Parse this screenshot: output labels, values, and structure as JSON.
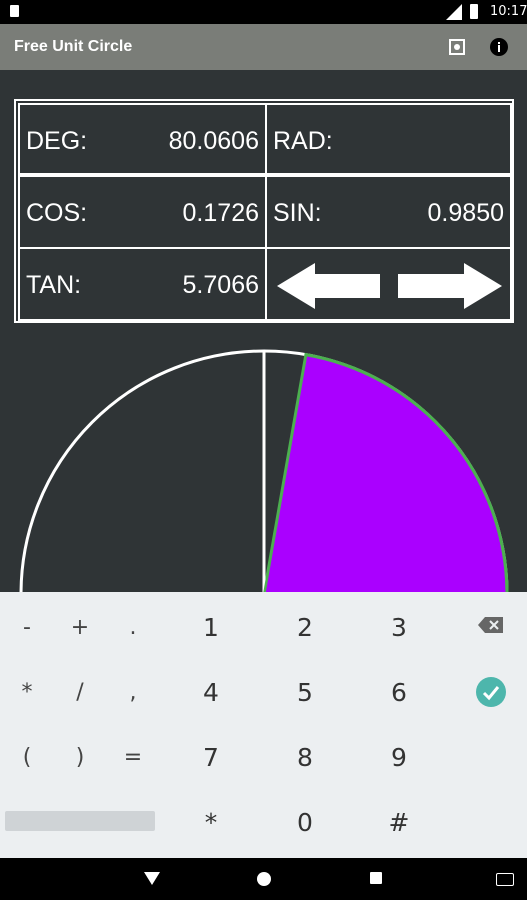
{
  "status_bar": {
    "time": "10:17"
  },
  "app_bar": {
    "title": "Free Unit Circle"
  },
  "values": {
    "deg_label": "DEG:",
    "deg_value": "80.0606",
    "rad_label": "RAD:",
    "rad_value": "",
    "cos_label": "COS:",
    "cos_value": "0.1726",
    "sin_label": "SIN:",
    "sin_value": "0.9850",
    "tan_label": "TAN:",
    "tan_value": "5.7066"
  },
  "circle": {
    "angle_degrees": 80.0606,
    "sector_color": "#aa00ff",
    "arc_color": "#4caf50",
    "outline_color": "#ffffff"
  },
  "keyboard": {
    "rows": [
      [
        "-",
        "+",
        ".",
        "1",
        "2",
        "3"
      ],
      [
        "*",
        "/",
        ",",
        "4",
        "5",
        "6"
      ],
      [
        "(",
        ")",
        "=",
        "7",
        "8",
        "9"
      ],
      [
        "",
        "",
        "",
        "*",
        "0",
        "#"
      ]
    ]
  },
  "colors": {
    "background": "#2f3436",
    "app_bar": "#7a7d78",
    "keyboard_bg": "#eceff1",
    "done_key": "#4db6ac"
  }
}
